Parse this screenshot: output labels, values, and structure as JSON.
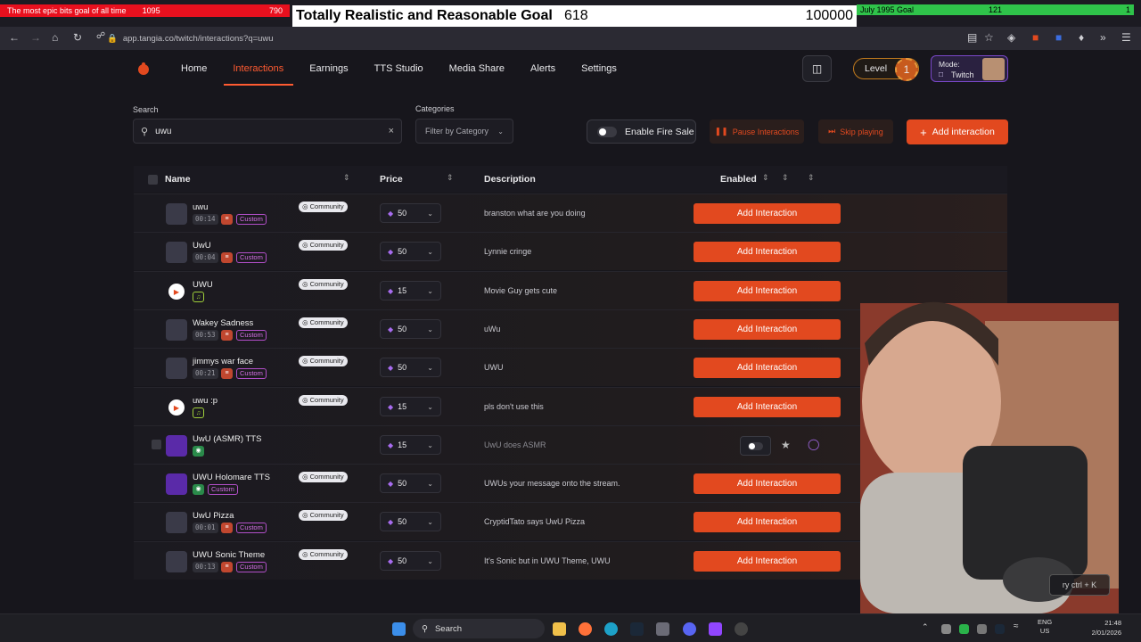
{
  "overlay": {
    "goal_left": {
      "title": "The most epic bits goal of all time",
      "bits": "1095",
      "value": "790"
    },
    "goal_center": {
      "title": "Totally Realistic and Reasonable Goal",
      "current": "618",
      "target": "100000"
    },
    "goal_right": {
      "title": "July 1995 Goal",
      "current": "121",
      "value": "1"
    }
  },
  "browser": {
    "url": "app.tangia.co/twitch/interactions?q=uwu"
  },
  "nav": {
    "links": [
      "Home",
      "Interactions",
      "Earnings",
      "TTS Studio",
      "Media Share",
      "Alerts",
      "Settings"
    ],
    "level_label": "Level",
    "level_value": "1",
    "mode_label": "Mode:",
    "mode_value": "Twitch"
  },
  "filters": {
    "search_label": "Search",
    "search_value": "uwu",
    "categories_label": "Categories",
    "category_placeholder": "Filter by Category",
    "fire_sale_label": "Enable Fire Sale",
    "pause_label": "Pause Interactions",
    "skip_label": "Skip playing",
    "add_label": "Add interaction"
  },
  "table": {
    "headers": {
      "name": "Name",
      "price": "Price",
      "description": "Description",
      "enabled": "Enabled"
    },
    "community_label": "Community",
    "custom_label": "Custom",
    "add_button_label": "Add Interaction",
    "rows": [
      {
        "name": "uwu",
        "duration": "00:14",
        "custom": true,
        "community": true,
        "price": "50",
        "description": "branston what are you doing",
        "kind": "video"
      },
      {
        "name": "UwU",
        "duration": "00:04",
        "custom": true,
        "community": true,
        "price": "50",
        "description": "Lynnie cringe",
        "kind": "video"
      },
      {
        "name": "UWU",
        "duration": "",
        "custom": false,
        "community": true,
        "price": "15",
        "description": "Movie Guy gets cute",
        "kind": "play"
      },
      {
        "name": "Wakey Sadness",
        "duration": "00:53",
        "custom": true,
        "community": true,
        "price": "50",
        "description": "uWu",
        "kind": "video"
      },
      {
        "name": "jimmys war face",
        "duration": "00:21",
        "custom": true,
        "community": true,
        "price": "50",
        "description": "UWU",
        "kind": "video"
      },
      {
        "name": "uwu :p",
        "duration": "",
        "custom": false,
        "community": true,
        "price": "15",
        "description": "pls don't use this",
        "kind": "play"
      },
      {
        "name": "UwU (ASMR) TTS",
        "duration": "",
        "custom": false,
        "community": false,
        "price": "15",
        "description": "UwU does ASMR",
        "kind": "tts"
      },
      {
        "name": "UWU Holomare TTS",
        "duration": "",
        "custom": true,
        "community": true,
        "price": "50",
        "description": "UWUs your message onto the stream.",
        "kind": "tts"
      },
      {
        "name": "UwU Pizza",
        "duration": "00:01",
        "custom": true,
        "community": true,
        "price": "50",
        "description": "CryptidTato says UwU Pizza",
        "kind": "video"
      },
      {
        "name": "UWU Sonic Theme",
        "duration": "00:13",
        "custom": true,
        "community": true,
        "price": "50",
        "description": "It's Sonic but in UWU Theme, UWU",
        "kind": "video"
      }
    ]
  },
  "webcam": {
    "hint": "ry ctrl + K"
  },
  "taskbar": {
    "search_label": "Search",
    "lang_top": "ENG",
    "lang_bottom": "US",
    "time": "21:48",
    "date": "2/01/2026"
  },
  "colors": {
    "accent": "#e2491f",
    "purple": "#a86cf0",
    "bg": "#17161c"
  }
}
